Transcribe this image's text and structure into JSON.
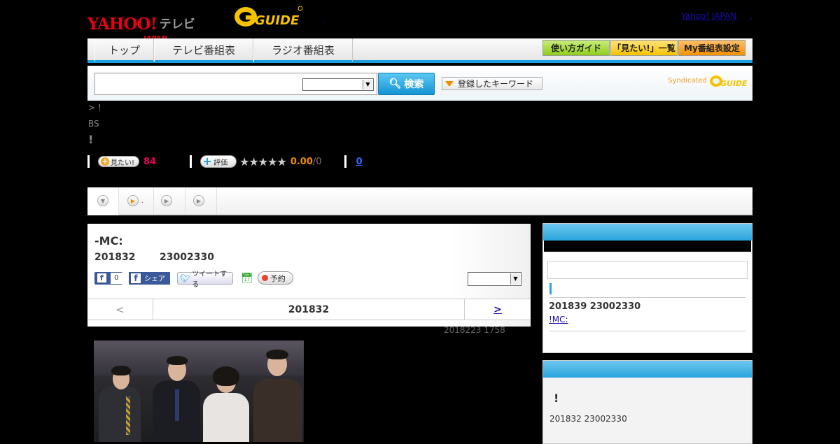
{
  "header": {
    "logo_yahoo": "YAHOO!",
    "logo_japan": "JAPAN",
    "logo_tv": "テレビ",
    "logo_gguide": "GUIDE",
    "yahoo_link": "Yahoo! JAPAN",
    "dot_link": ",",
    "dot_link2": ","
  },
  "nav": {
    "tabs": [
      "トップ",
      "テレビ番組表",
      "ラジオ番組表"
    ],
    "buttons": [
      "使い方ガイド",
      "「見たい!」一覧",
      "My番組表設定"
    ]
  },
  "search": {
    "input_value": "",
    "select_value": "",
    "button_label": "検索",
    "keyword_label": "登録したキーワード",
    "syndicated": "Syndicated",
    "syndicated_logo": "GUIDE"
  },
  "program": {
    "breadcrumb": "> !",
    "channel": "BS",
    "title_mark": "!",
    "mitai_label": "見たい!",
    "mitai_count": "84",
    "rate_label": "評価",
    "stars": "★★★★★",
    "score": "0.00",
    "score_den": "/0",
    "comment_count": "0"
  },
  "tabs": [
    {
      "label": ""
    },
    {
      "label": "."
    },
    {
      "label": ""
    },
    {
      "label": ""
    }
  ],
  "detail": {
    "title": "-MC:",
    "date": "201832",
    "time": "23002330",
    "fb_count": "0",
    "share_label": "シェア",
    "tweet_label": "ツイートする",
    "reserve_label": "予約",
    "select_value": "",
    "pager_prev": "<",
    "pager_current": "201832",
    "pager_next": ">",
    "updated": "2018223  1758"
  },
  "sidebar": {
    "box1_datetime": "201839  23002330",
    "box1_link": "!MC:",
    "box2_title": "!",
    "box2_datetime": "201832  23002330"
  },
  "colors": {
    "accent_blue": "#1ba0dc",
    "yahoo_red": "#e60012",
    "mitai_pink": "#e6005c",
    "score_orange": "#f08c00"
  }
}
